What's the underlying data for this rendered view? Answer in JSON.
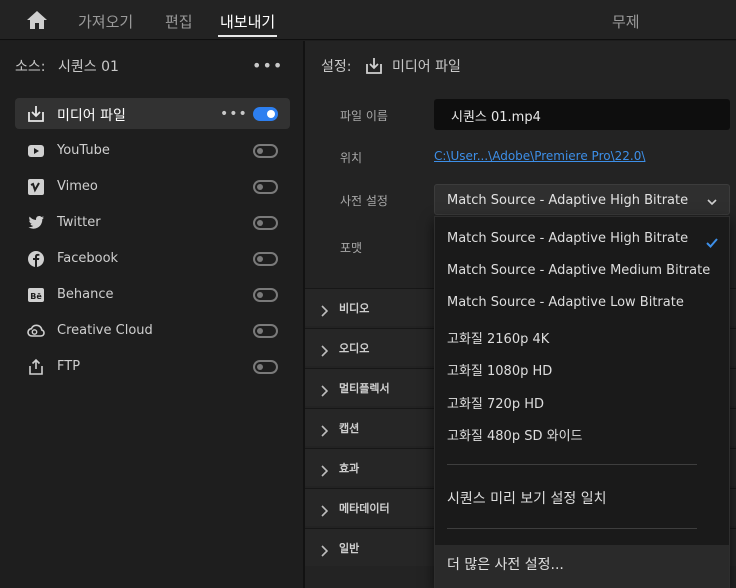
{
  "topbar": {
    "tabs": [
      "가져오기",
      "편집",
      "내보내기"
    ],
    "active_tab": "내보내기",
    "title": "무제"
  },
  "source": {
    "label": "소스:",
    "value": "시퀀스 01",
    "more": "•••"
  },
  "destinations": [
    {
      "label": "미디어 파일",
      "icon": "media-file-export-icon",
      "enabled": true
    },
    {
      "label": "YouTube",
      "icon": "youtube-icon",
      "enabled": false
    },
    {
      "label": "Vimeo",
      "icon": "vimeo-icon",
      "enabled": false
    },
    {
      "label": "Twitter",
      "icon": "twitter-icon",
      "enabled": false
    },
    {
      "label": "Facebook",
      "icon": "facebook-icon",
      "enabled": false
    },
    {
      "label": "Behance",
      "icon": "behance-icon",
      "enabled": false
    },
    {
      "label": "Creative Cloud",
      "icon": "creative-cloud-icon",
      "enabled": false
    },
    {
      "label": "FTP",
      "icon": "ftp-upload-icon",
      "enabled": false
    }
  ],
  "settings": {
    "label": "설정:",
    "value": "미디어 파일",
    "filename_label": "파일 이름",
    "filename_value": "시퀀스 01.mp4",
    "location_label": "위치",
    "location_value": "C:\\User...\\Adobe\\Premiere Pro\\22.0\\",
    "preset_label": "사전 설정",
    "preset_value": "Match Source - Adaptive High Bitrate",
    "format_label": "포맷"
  },
  "sections": [
    "비디오",
    "오디오",
    "멀티플렉서",
    "캡션",
    "효과",
    "메타데이터",
    "일반"
  ],
  "preset_dropdown": {
    "items": [
      "Match Source - Adaptive High Bitrate",
      "Match Source - Adaptive Medium Bitrate",
      "Match Source - Adaptive Low Bitrate",
      "고화질 2160p 4K",
      "고화질 1080p HD",
      "고화질 720p HD",
      "고화질 480p SD 와이드"
    ],
    "selected": "Match Source - Adaptive High Bitrate",
    "match_sequence": "시퀀스 미리 보기 설정 일치",
    "more_presets": "더 많은 사전 설정..."
  },
  "colors": {
    "accent": "#2d7ff0",
    "link": "#3d8fe8",
    "background": "#1d1d1d"
  }
}
